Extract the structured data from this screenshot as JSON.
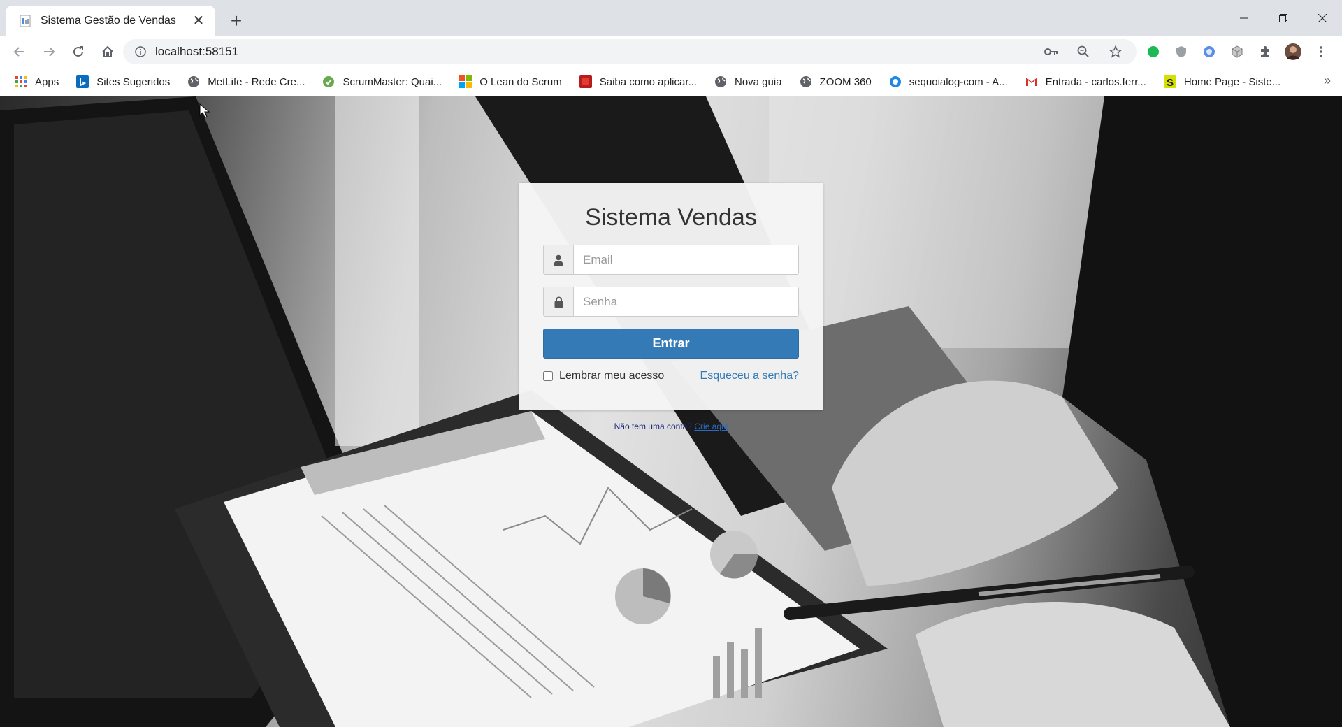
{
  "browser": {
    "tab": {
      "title": "Sistema Gestão de Vendas",
      "favicon": "document-icon"
    },
    "address": {
      "url": "localhost:58151"
    },
    "bookmarks": [
      {
        "label": "Apps",
        "icon": "apps-grid-icon"
      },
      {
        "label": "Sites Sugeridos",
        "icon": "bing-icon"
      },
      {
        "label": "MetLife - Rede Cre...",
        "icon": "globe-icon"
      },
      {
        "label": "ScrumMaster: Quai...",
        "icon": "scrum-icon"
      },
      {
        "label": "O Lean do Scrum",
        "icon": "microsoft-icon"
      },
      {
        "label": "Saiba como aplicar...",
        "icon": "book-icon"
      },
      {
        "label": "Nova guia",
        "icon": "globe-icon"
      },
      {
        "label": "ZOOM 360",
        "icon": "globe-icon"
      },
      {
        "label": "sequoialog-com - A...",
        "icon": "circle-icon"
      },
      {
        "label": "Entrada - carlos.ferr...",
        "icon": "gmail-icon"
      },
      {
        "label": "Home Page - Siste...",
        "icon": "s-icon"
      }
    ],
    "bookmarks_more": "»",
    "colors": {
      "tabstrip": "#dee1e6",
      "toolbar": "#ffffff"
    }
  },
  "login": {
    "title": "Sistema Vendas",
    "email_placeholder": "Email",
    "password_placeholder": "Senha",
    "submit_label": "Entrar",
    "remember_label": "Lembrar meu acesso",
    "remember_checked": false,
    "forgot_label": "Esqueceu a senha?",
    "signup_text": "Não tem uma conta?",
    "signup_link": "Crie aqui",
    "colors": {
      "primary": "#337ab7",
      "link": "#337ab7"
    }
  }
}
